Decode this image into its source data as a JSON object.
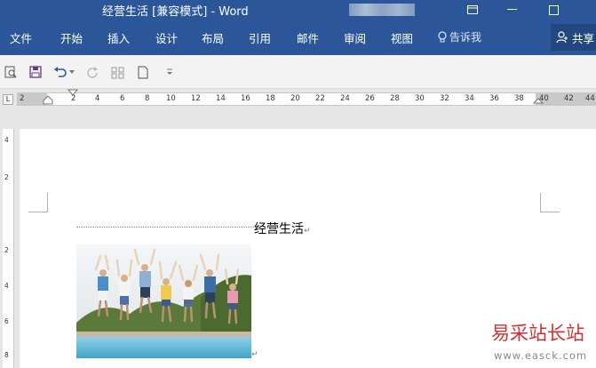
{
  "titlebar": {
    "title": "经营生活 [兼容模式] - Word",
    "ribbon_display_icon": "ribbon-display-icon",
    "minimize_icon": "minimize-icon",
    "maximize_icon": "maximize-icon"
  },
  "ribbon": {
    "tabs": [
      "文件",
      "开始",
      "插入",
      "设计",
      "布局",
      "引用",
      "邮件",
      "审阅",
      "视图"
    ],
    "tell_me": "告诉我",
    "share": "共享"
  },
  "qat": {
    "icons": [
      "print-preview-icon",
      "save-icon",
      "undo-icon",
      "dropdown-icon",
      "redo-icon",
      "layout-icon",
      "new-document-icon",
      "customize-icon"
    ]
  },
  "ruler": {
    "tab_selector": "L",
    "numbers": [
      "2",
      "2",
      "4",
      "6",
      "8",
      "10",
      "12",
      "14",
      "16",
      "18",
      "20",
      "22",
      "24",
      "26",
      "28",
      "30",
      "32",
      "34",
      "36",
      "38",
      "40",
      "42",
      "44"
    ],
    "vertical_numbers": [
      "4",
      "2",
      "2",
      "4",
      "6",
      "8"
    ]
  },
  "document": {
    "heading": "经营生活",
    "paragraph_mark": "↵"
  },
  "watermark": {
    "text": "易采站长站",
    "url": "www.easck.com"
  },
  "colors": {
    "ribbon_blue": "#2b579a",
    "watermark_red": "#cc3333"
  }
}
